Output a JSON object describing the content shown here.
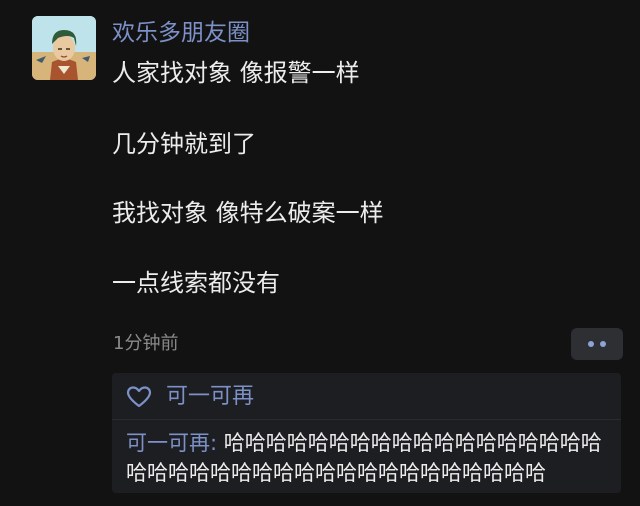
{
  "post": {
    "author": "欢乐多朋友圈",
    "avatar_icon": "cartoon-character-avatar-icon",
    "lines": [
      "人家找对象 像报警一样",
      "几分钟就到了",
      "我找对象 像特么破案一样",
      "一点线索都没有"
    ],
    "timestamp": "1分钟前",
    "more_icon": "more-dots-icon"
  },
  "interactions": {
    "like_icon": "heart-outline-icon",
    "likes": "可一可再",
    "comments": [
      {
        "author": "可一可再",
        "separator": ": ",
        "text": "哈哈哈哈哈哈哈哈哈哈哈哈哈哈哈哈哈哈哈哈哈哈哈哈哈哈哈哈哈哈哈哈哈哈哈哈哈哈"
      }
    ]
  },
  "colors": {
    "background": "#121212",
    "name_link": "#7d91c8",
    "text": "#ececec",
    "timestamp": "#8a8a8a",
    "panel": "#1d1e21"
  }
}
